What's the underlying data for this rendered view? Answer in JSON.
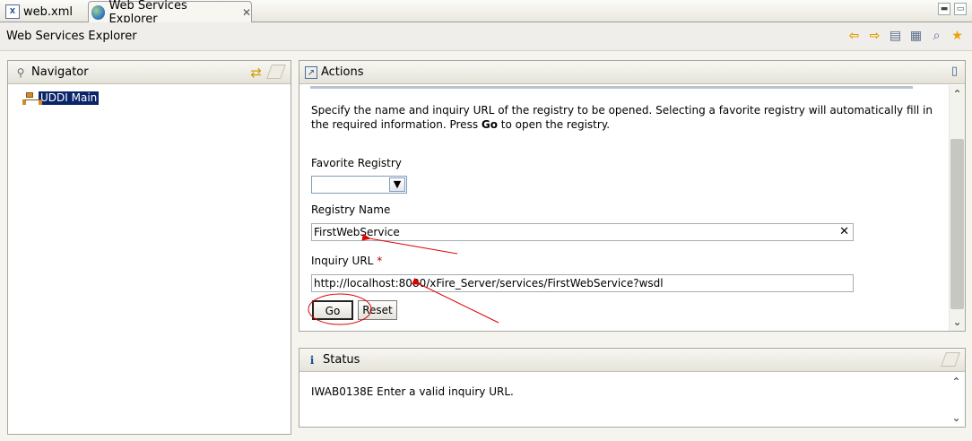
{
  "tabs": [
    {
      "label": "web.xml",
      "icon": "xml-file-icon"
    },
    {
      "label": "Web Services Explorer",
      "icon": "globe-icon",
      "active": true
    }
  ],
  "titlebar": {
    "title": "Web Services Explorer"
  },
  "navigator": {
    "title": "Navigator",
    "tree": [
      {
        "label": "UDDI Main",
        "selected": true
      }
    ]
  },
  "actions": {
    "title": "Actions",
    "description_pre": "Specify the name and inquiry URL of the registry to be opened. Selecting a favorite registry will automatically fill in the required information. Press ",
    "description_bold": "Go",
    "description_post": " to open the registry.",
    "favorite_label": "Favorite Registry",
    "favorite_value": "",
    "name_label": "Registry Name",
    "name_value": "FirstWebService",
    "url_label": "Inquiry URL",
    "url_required_marker": "*",
    "url_value": "http://localhost:8080/xFire_Server/services/FirstWebService?wsdl",
    "go_label": "Go",
    "reset_label": "Reset"
  },
  "status": {
    "title": "Status",
    "message": "IWAB0138E Enter a valid inquiry URL."
  },
  "colors": {
    "annotation": "#e00000",
    "selection": "#0a246a",
    "required": "#c00000"
  }
}
